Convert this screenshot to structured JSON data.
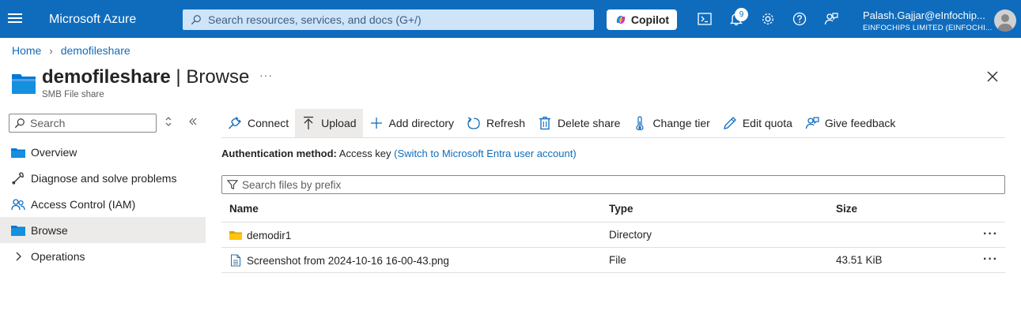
{
  "topbar": {
    "brand": "Microsoft Azure",
    "search_placeholder": "Search resources, services, and docs (G+/)",
    "copilot_label": "Copilot",
    "notification_count": "9",
    "user_name": "Palash.Gajjar@eInfochip...",
    "user_org": "EINFOCHIPS LIMITED (EINFOCHI...",
    "brand_color": "#0f6cbd"
  },
  "breadcrumb": {
    "home": "Home",
    "current": "demofileshare"
  },
  "page": {
    "title_bold": "demofileshare",
    "title_sep": " | ",
    "title_rest": "Browse",
    "subtitle": "SMB File share",
    "more": "···"
  },
  "nav": {
    "search_placeholder": "Search",
    "items": [
      {
        "label": "Overview",
        "icon": "overview-icon"
      },
      {
        "label": "Diagnose and solve problems",
        "icon": "wrench-icon"
      },
      {
        "label": "Access Control (IAM)",
        "icon": "people-icon"
      },
      {
        "label": "Browse",
        "icon": "folder-icon",
        "active": true
      },
      {
        "label": "Operations",
        "icon": "chevron-right-icon"
      }
    ]
  },
  "toolbar": {
    "connect": "Connect",
    "upload": "Upload",
    "add_directory": "Add directory",
    "refresh": "Refresh",
    "delete_share": "Delete share",
    "change_tier": "Change tier",
    "edit_quota": "Edit quota",
    "give_feedback": "Give feedback"
  },
  "auth": {
    "label": "Authentication method:",
    "value": "Access key",
    "switch_link": "(Switch to Microsoft Entra user account)"
  },
  "files": {
    "search_placeholder": "Search files by prefix",
    "columns": {
      "name": "Name",
      "type": "Type",
      "size": "Size"
    },
    "rows": [
      {
        "name": "demodir1",
        "type": "Directory",
        "size": "",
        "icon": "folder-icon"
      },
      {
        "name": "Screenshot from 2024-10-16 16-00-43.png",
        "type": "File",
        "size": "43.51 KiB",
        "icon": "file-icon"
      }
    ],
    "row_more": "···"
  }
}
